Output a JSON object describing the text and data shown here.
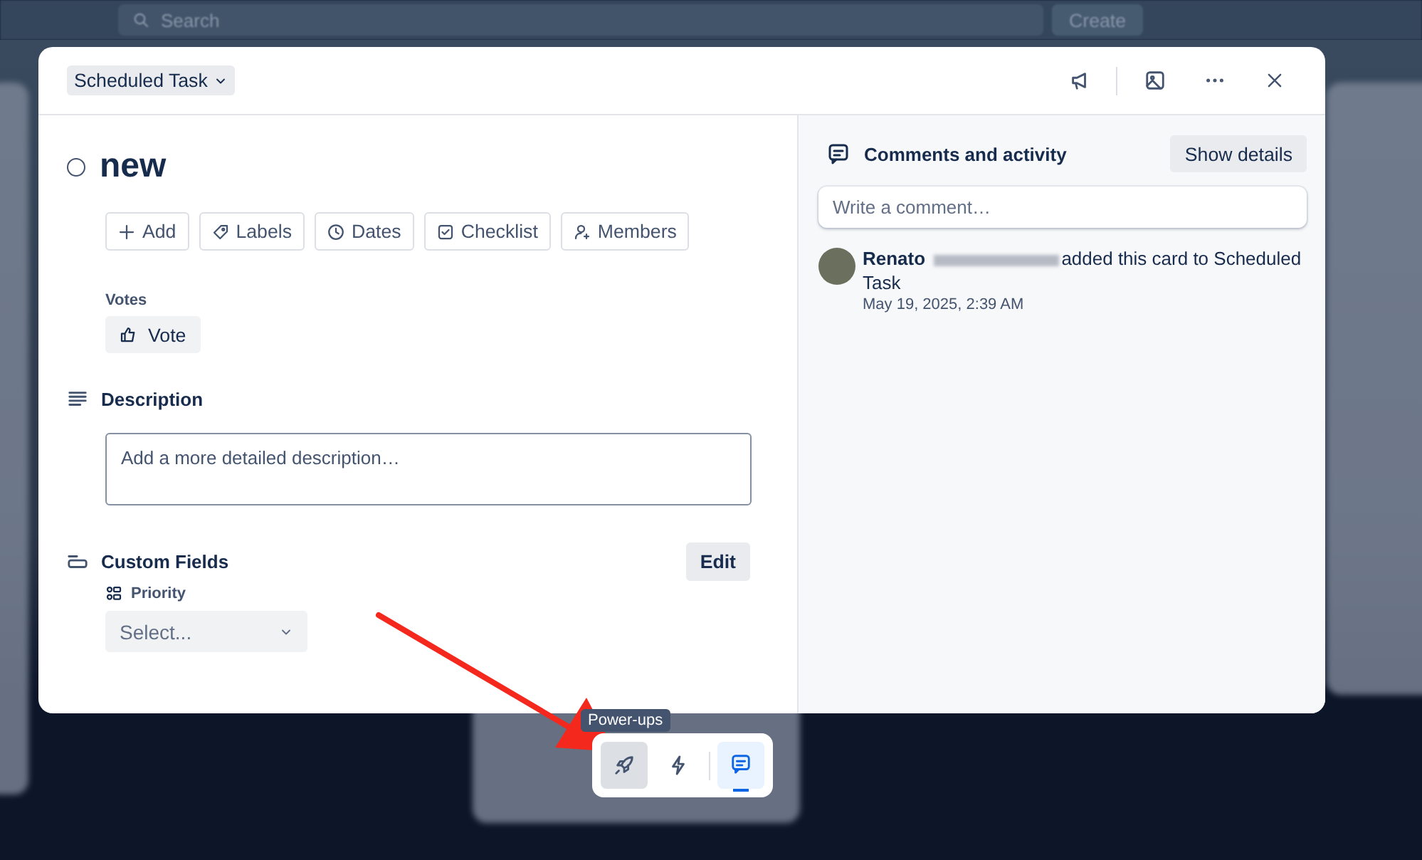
{
  "background": {
    "search": {
      "placeholder": "Search"
    },
    "create_button": "Create"
  },
  "card": {
    "list_button": "Scheduled Task",
    "title": "new",
    "completed": false,
    "actions": [
      {
        "kind": "plus",
        "label": "Add"
      },
      {
        "kind": "tag",
        "label": "Labels"
      },
      {
        "kind": "clock",
        "label": "Dates"
      },
      {
        "kind": "check",
        "label": "Checklist"
      },
      {
        "kind": "person",
        "label": "Members"
      }
    ],
    "votes": {
      "label": "Votes",
      "button": "Vote"
    },
    "description": {
      "heading": "Description",
      "placeholder": "Add a more detailed description…"
    },
    "custom_fields": {
      "heading": "Custom Fields",
      "edit_button": "Edit",
      "fields": [
        {
          "label": "Priority",
          "placeholder": "Select..."
        }
      ]
    }
  },
  "activity": {
    "heading": "Comments and activity",
    "toggle_button": "Show details",
    "comment_placeholder": "Write a comment…",
    "entries": [
      {
        "author": "Renato",
        "text": "added this card to Scheduled Task",
        "time": "May 19, 2025, 2:39 AM"
      }
    ]
  },
  "dock": {
    "tooltip": "Power-ups",
    "buttons": [
      {
        "kind": "rocket",
        "hovered": true,
        "selected": false
      },
      {
        "kind": "bolt",
        "hovered": false,
        "selected": false
      },
      {
        "kind": "comment",
        "hovered": false,
        "selected": true
      }
    ]
  }
}
